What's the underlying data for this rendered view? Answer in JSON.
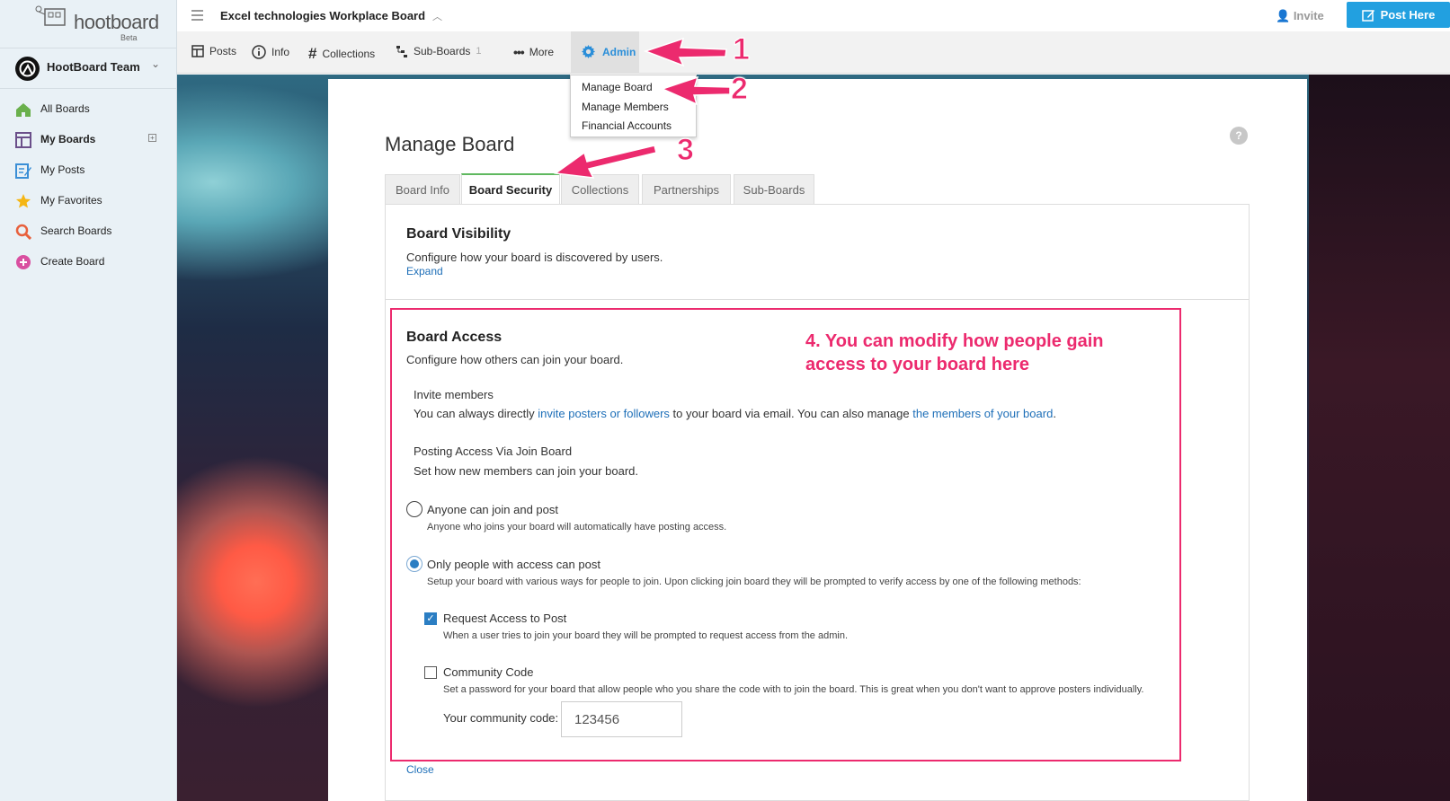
{
  "app": {
    "logo_text": "hootboard",
    "logo_badge": "Beta",
    "team_name": "HootBoard Team"
  },
  "sidebar": {
    "items": [
      {
        "label": "All Boards",
        "icon": "home-icon",
        "color": "#6ab04c"
      },
      {
        "label": "My Boards",
        "icon": "boards-icon",
        "color": "#6b4f8a"
      },
      {
        "label": "My Posts",
        "icon": "edit-icon",
        "color": "#3b8fd6"
      },
      {
        "label": "My Favorites",
        "icon": "star-icon",
        "color": "#f5b614"
      },
      {
        "label": "Search Boards",
        "icon": "search-icon",
        "color": "#e8603c"
      },
      {
        "label": "Create Board",
        "icon": "plus-circle-icon",
        "color": "#d94fa0"
      }
    ],
    "add_glyph": "+"
  },
  "topbar": {
    "board_title": "Excel technologies Workplace Board",
    "invite_label": "Invite",
    "post_here_label": "Post Here",
    "accent": "#22a0e0"
  },
  "tabbar": {
    "posts": "Posts",
    "info": "Info",
    "collections": "Collections",
    "subboards": "Sub-Boards",
    "subboards_count": "1",
    "more": "More",
    "admin": "Admin"
  },
  "admin_menu": [
    "Manage Board",
    "Manage Members",
    "Financial Accounts"
  ],
  "manage": {
    "title": "Manage Board",
    "help": "?",
    "tabs": [
      "Board Info",
      "Board Security",
      "Collections",
      "Partnerships",
      "Sub-Boards"
    ],
    "active_tab": "Board Security",
    "visibility": {
      "title": "Board Visibility",
      "desc": "Configure how your board is discovered by users.",
      "expand": "Expand"
    },
    "access": {
      "title": "Board Access",
      "desc": "Configure how others can join your board.",
      "invite_title": "Invite members",
      "invite_pre": "You can always directly ",
      "invite_link1": "invite posters or followers",
      "invite_mid": " to your board via email. You can also manage ",
      "invite_link2": "the members of your board",
      "invite_post": ".",
      "posting_title": "Posting Access Via Join Board",
      "posting_desc": "Set how new members can join your board.",
      "opt1_label": "Anyone can join and post",
      "opt1_desc": "Anyone who joins your board will automatically have posting access.",
      "opt2_label": "Only people with access can post",
      "opt2_desc": "Setup your board with various ways for people to join. Upon clicking join board they will be prompted to verify access by one of the following methods:",
      "req_label": "Request Access to Post",
      "req_desc": "When a user tries to join your board they will be prompted to request access from the admin.",
      "code_label": "Community Code",
      "code_desc": "Set a password for your board that allow people who you share the code with to join the board. This is great when you don't want to approve posters individually.",
      "code_field_label": "Your community code:",
      "code_value": "123456",
      "selected_option": "Only people with access can post",
      "request_checked": true,
      "code_checked": false
    },
    "close": "Close"
  },
  "annotations": {
    "n1": "1",
    "n2": "2",
    "n3": "3",
    "note": "4. You can modify how people gain access to your board here",
    "color": "#ec2a6e"
  }
}
